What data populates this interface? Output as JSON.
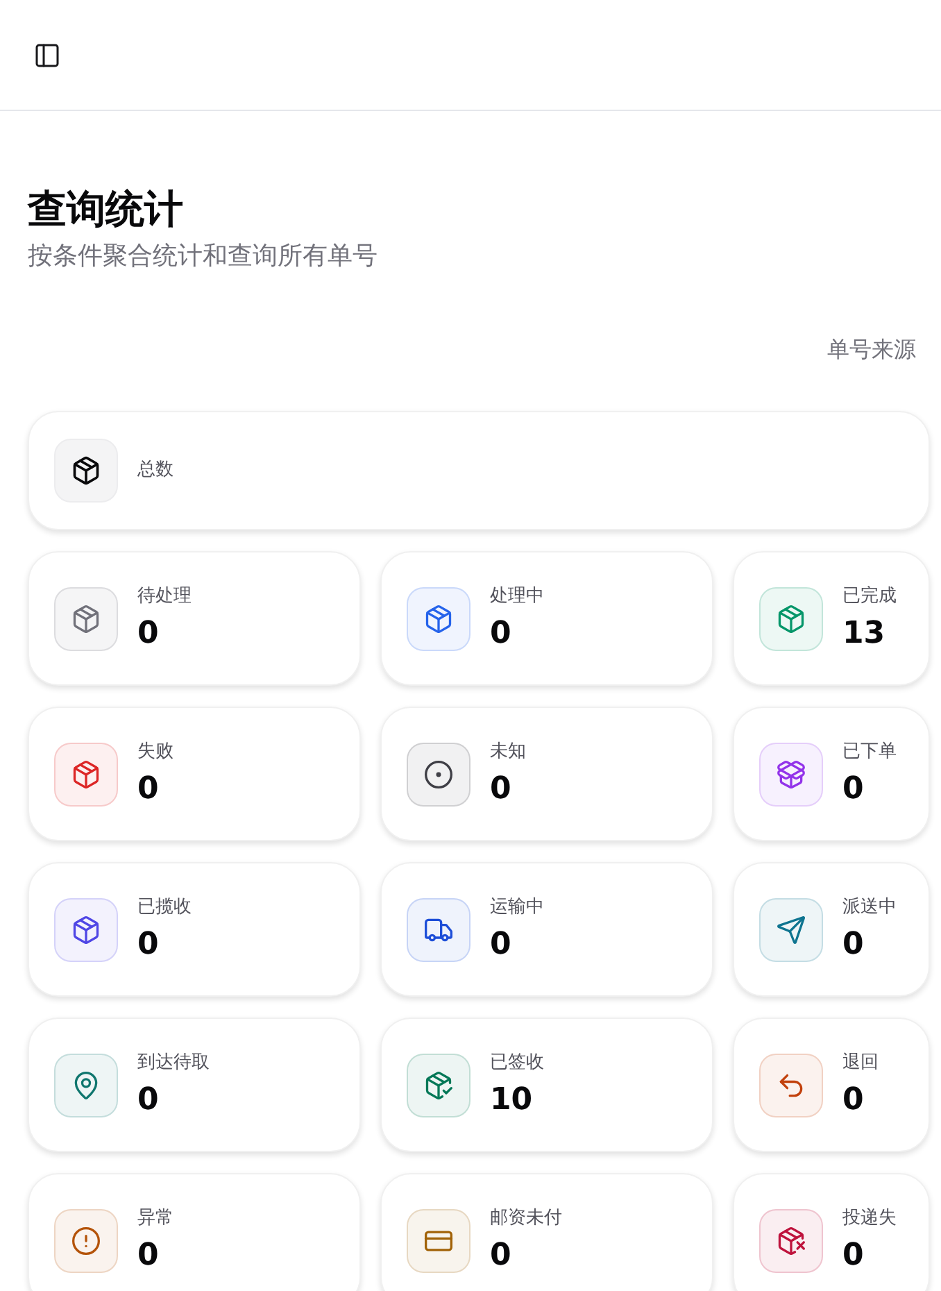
{
  "header": {
    "title": "查询统计",
    "subtitle": "按条件聚合统计和查询所有单号",
    "filter_label": "单号来源"
  },
  "total": {
    "label": "总数"
  },
  "stats": [
    {
      "label": "待处理",
      "value": "0",
      "color": "#71717a"
    },
    {
      "label": "处理中",
      "value": "0",
      "color": "#2563eb"
    },
    {
      "label": "已完成",
      "value": "13",
      "color": "#059669"
    },
    {
      "label": "失败",
      "value": "0",
      "color": "#dc2626"
    },
    {
      "label": "未知",
      "value": "0",
      "color": "#3f3f46"
    },
    {
      "label": "已下单",
      "value": "0",
      "color": "#9333ea"
    },
    {
      "label": "已揽收",
      "value": "0",
      "color": "#4f46e5"
    },
    {
      "label": "运输中",
      "value": "0",
      "color": "#1d4ed8"
    },
    {
      "label": "派送中",
      "value": "0",
      "color": "#0e7490"
    },
    {
      "label": "到达待取",
      "value": "0",
      "color": "#0f766e"
    },
    {
      "label": "已签收",
      "value": "10",
      "color": "#047857"
    },
    {
      "label": "退回",
      "value": "0",
      "color": "#c2410c"
    },
    {
      "label": "异常",
      "value": "0",
      "color": "#b45309"
    },
    {
      "label": "邮资未付",
      "value": "0",
      "color": "#a16207"
    },
    {
      "label": "投递失",
      "value": "0",
      "color": "#be123c"
    }
  ]
}
